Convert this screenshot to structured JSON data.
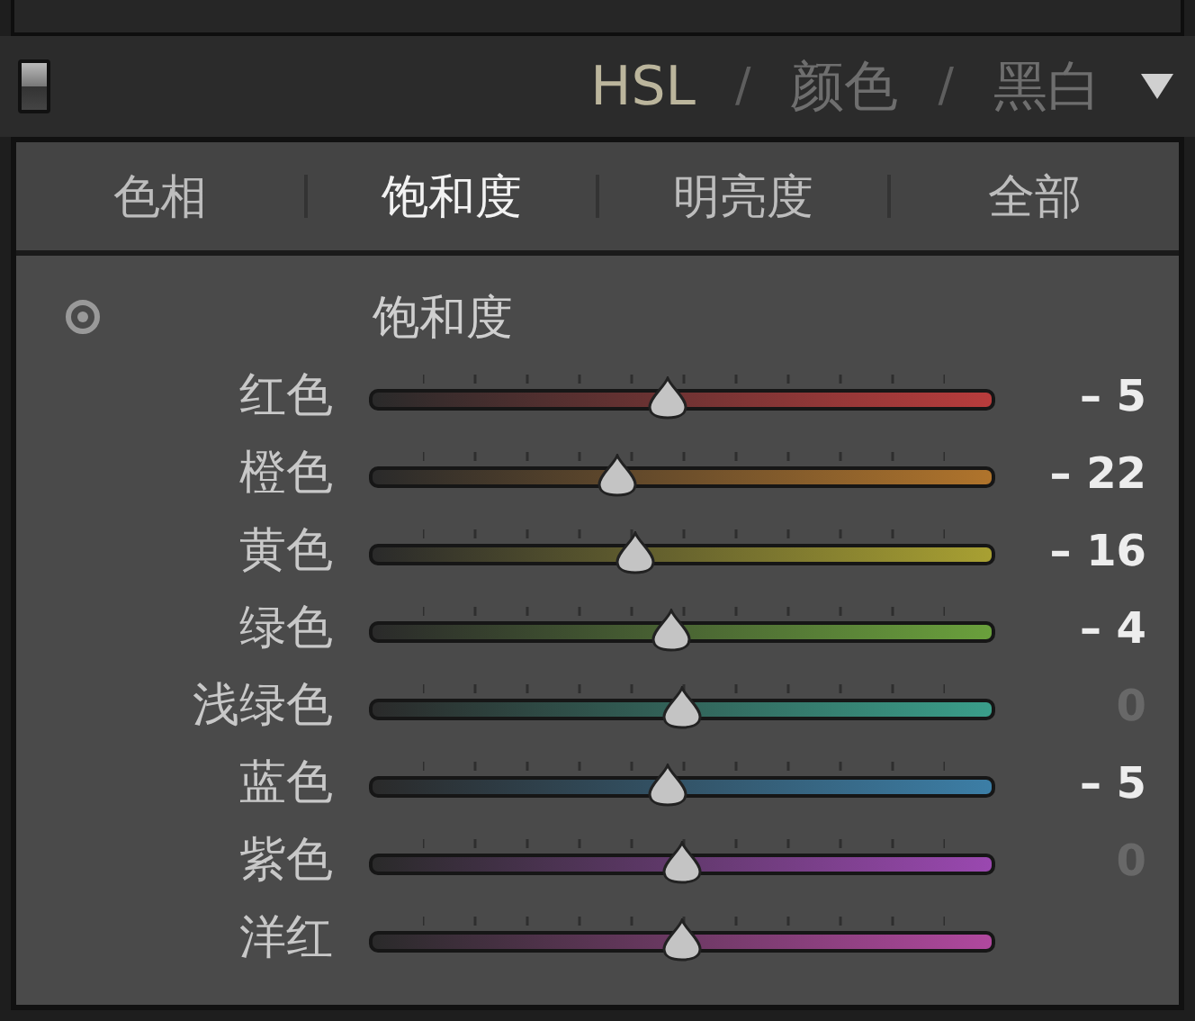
{
  "header": {
    "modes": [
      {
        "label": "HSL",
        "selected": true
      },
      {
        "label": "颜色",
        "selected": false
      },
      {
        "label": "黑白",
        "selected": false
      }
    ],
    "separator": "/"
  },
  "tabs": [
    {
      "label": "色相",
      "selected": false
    },
    {
      "label": "饱和度",
      "selected": true
    },
    {
      "label": "明亮度",
      "selected": false
    },
    {
      "label": "全部",
      "selected": false
    }
  ],
  "section_title": "饱和度",
  "sliders": [
    {
      "name": "红色",
      "level": 0.475,
      "reading": "– 5",
      "dimmed": false,
      "color": "#b83c3c"
    },
    {
      "name": "橙色",
      "level": 0.39,
      "reading": "– 22",
      "dimmed": false,
      "color": "#b0742c"
    },
    {
      "name": "黄色",
      "level": 0.42,
      "reading": "– 16",
      "dimmed": false,
      "color": "#a8a032"
    },
    {
      "name": "绿色",
      "level": 0.48,
      "reading": "– 4",
      "dimmed": false,
      "color": "#6aa03c"
    },
    {
      "name": "浅绿色",
      "level": 0.5,
      "reading": "0",
      "dimmed": true,
      "color": "#3a9e8a"
    },
    {
      "name": "蓝色",
      "level": 0.475,
      "reading": "– 5",
      "dimmed": false,
      "color": "#3c7ea6"
    },
    {
      "name": "紫色",
      "level": 0.5,
      "reading": "0",
      "dimmed": true,
      "color": "#9a48b0"
    },
    {
      "name": "洋红",
      "level": 0.5,
      "color": "#b0489e"
    }
  ]
}
